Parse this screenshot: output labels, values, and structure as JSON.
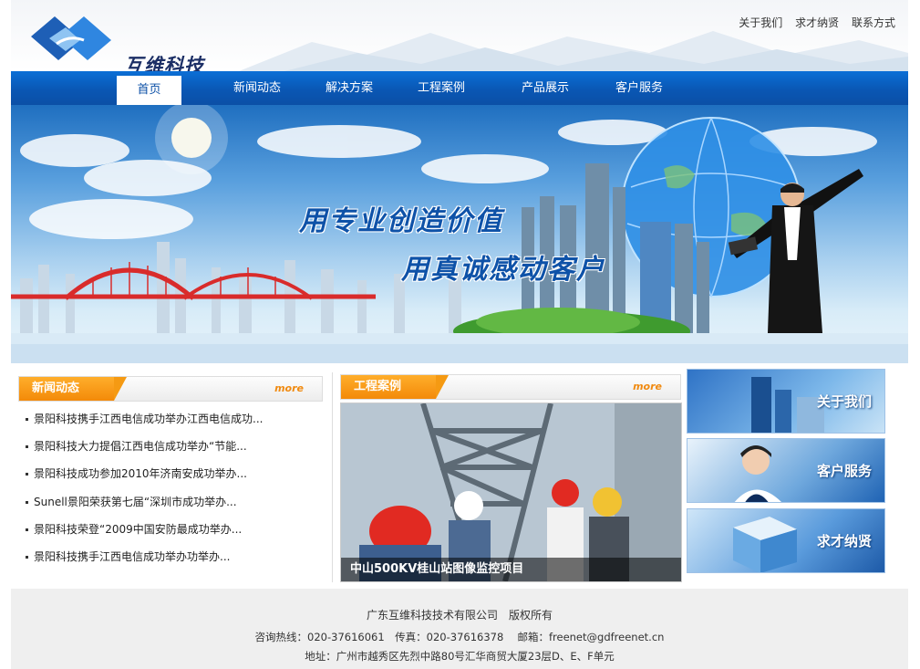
{
  "site": {
    "logo_text": "互维科技",
    "top_links": [
      "关于我们",
      "求才纳贤",
      "联系方式"
    ]
  },
  "nav": {
    "items": [
      "首页",
      "新闻动态",
      "解决方案",
      "工程案例",
      "产品展示",
      "客户服务"
    ],
    "active": "首页"
  },
  "banner": {
    "slogan_line1": "用专业创造价值",
    "slogan_line2": "用真诚感动客户"
  },
  "news": {
    "title": "新闻动态",
    "more": "more",
    "items": [
      "景阳科技携手江西电信成功举办江西电信成功...",
      "景阳科技大力提倡江西电信成功举办“节能...",
      "景阳科技成功参加2010年济南安成功举办...",
      "Sunell景阳荣获第七届“深圳市成功举办...",
      "景阳科技荣登“2009中国安防最成功举办...",
      "景阳科技携手江西电信成功举办功举办..."
    ]
  },
  "cases": {
    "title": "工程案例",
    "more": "more",
    "caption": "中山500KV桂山站图像监控项目"
  },
  "side": {
    "buttons": [
      "关于我们",
      "客户服务",
      "求才纳贤"
    ]
  },
  "footer": {
    "copyright": "广东互维科技技术有限公司　版权所有",
    "contact": "咨询热线：020-37616061　传真：020-37616378　 邮箱：freenet@gdfreenet.cn",
    "address": "地址：广州市越秀区先烈中路80号汇华商贸大厦23层D、E、F单元"
  },
  "colors": {
    "nav_blue": "#0a57b4",
    "accent_orange": "#f38a09",
    "footer_bg": "#efefef"
  }
}
